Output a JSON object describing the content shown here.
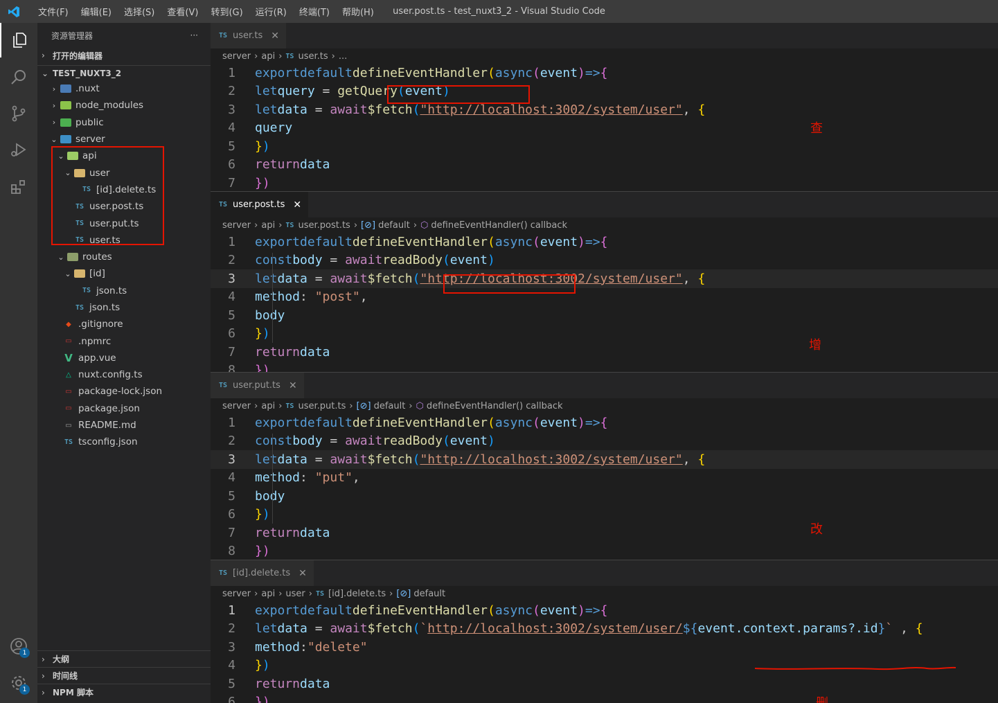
{
  "window": {
    "title": "user.post.ts - test_nuxt3_2 - Visual Studio Code",
    "menu": [
      "文件(F)",
      "编辑(E)",
      "选择(S)",
      "查看(V)",
      "转到(G)",
      "运行(R)",
      "终端(T)",
      "帮助(H)"
    ]
  },
  "activity": {
    "account_badge": "1",
    "settings_badge": "1"
  },
  "sidebar": {
    "title": "资源管理器",
    "more": "···",
    "open_editors": "打开的编辑器",
    "project": "TEST_NUXT3_2",
    "tree": [
      {
        "label": ".nuxt"
      },
      {
        "label": "node_modules"
      },
      {
        "label": "public"
      },
      {
        "label": "server"
      },
      {
        "label": "api"
      },
      {
        "label": "user"
      },
      {
        "label": "[id].delete.ts"
      },
      {
        "label": "user.post.ts"
      },
      {
        "label": "user.put.ts"
      },
      {
        "label": "user.ts"
      },
      {
        "label": "routes"
      },
      {
        "label": "[id]"
      },
      {
        "label": "json.ts"
      },
      {
        "label": "json.ts"
      },
      {
        "label": ".gitignore"
      },
      {
        "label": ".npmrc"
      },
      {
        "label": "app.vue"
      },
      {
        "label": "nuxt.config.ts"
      },
      {
        "label": "package-lock.json"
      },
      {
        "label": "package.json"
      },
      {
        "label": "README.md"
      },
      {
        "label": "tsconfig.json"
      }
    ],
    "outline": "大纲",
    "timeline": "时间线",
    "npm": "NPM 脚本"
  },
  "panes": {
    "p1": {
      "tab": "user.ts",
      "crumbs": {
        "a": "server",
        "b": "api",
        "c": "user.ts",
        "d": "..."
      },
      "annotation": "查"
    },
    "p2": {
      "tab": "user.post.ts",
      "crumbs": {
        "a": "server",
        "b": "api",
        "c": "user.post.ts",
        "d": "default",
        "e": "defineEventHandler() callback"
      },
      "annotation": "增"
    },
    "p3": {
      "tab": "user.put.ts",
      "crumbs": {
        "a": "server",
        "b": "api",
        "c": "user.put.ts",
        "d": "default",
        "e": "defineEventHandler() callback"
      },
      "annotation": "改"
    },
    "p4": {
      "tab": "[id].delete.ts",
      "crumbs": {
        "a": "server",
        "b": "api",
        "c": "user",
        "d": "[id].delete.ts",
        "e": "default"
      },
      "annotation": "删"
    }
  },
  "code": {
    "export": "export",
    "default": "default",
    "define": "defineEventHandler",
    "async": "async",
    "event": "event",
    "arrow": "=>",
    "let": "let",
    "const": "const",
    "query": "query",
    "getQuery": "getQuery",
    "data": "data",
    "await": "await",
    "fetch": "$fetch",
    "url": "\"http://localhost:3002/system/user\"",
    "url_tpl": "http://localhost:3002/system/user/",
    "tpl_expr": "event.context.params?.id",
    "body": "body",
    "readBody": "readBody",
    "method": "method",
    "post": "\"post\"",
    "put": "\"put\"",
    "delete": "\"delete\"",
    "return": "return"
  }
}
